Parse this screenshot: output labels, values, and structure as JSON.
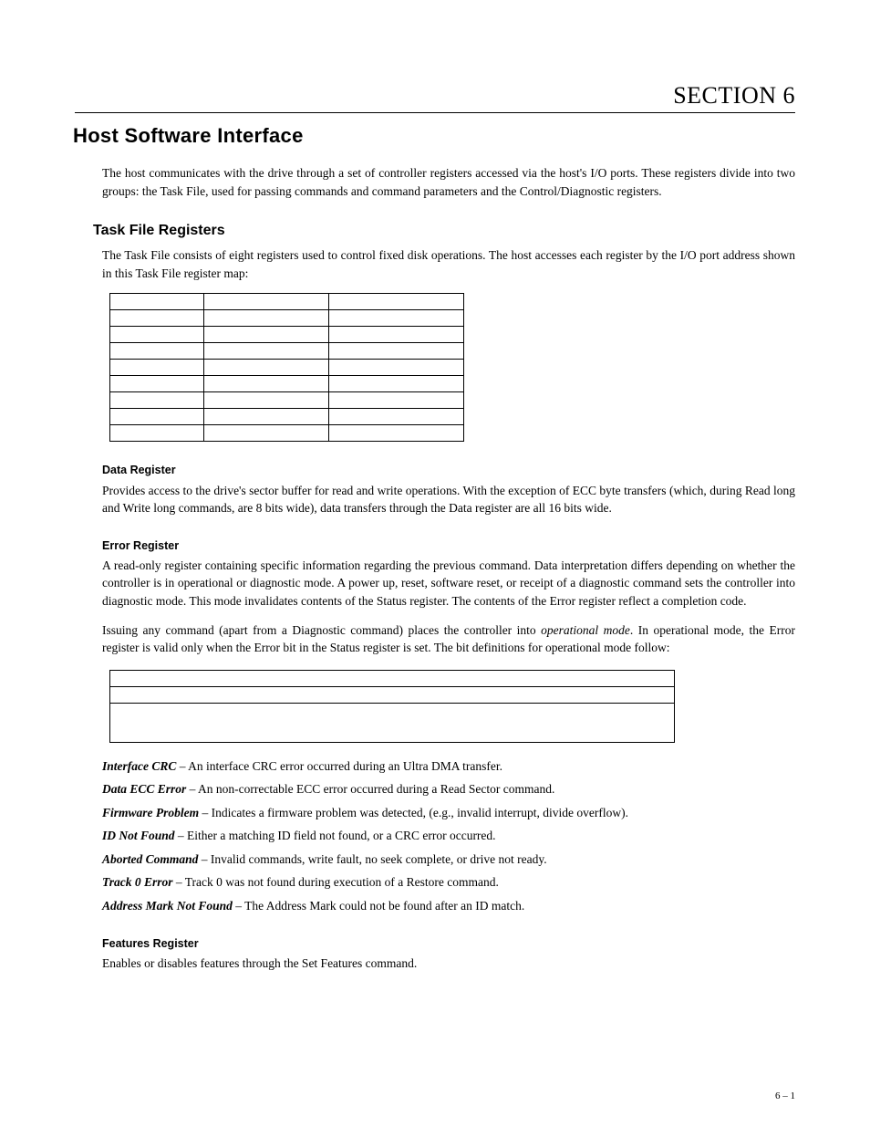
{
  "section_label": "SECTION 6",
  "title": "Host Software Interface",
  "intro": "The host communicates with the drive through a set of controller registers accessed via the host's I/O ports. These registers divide into two groups: the Task File, used for passing commands and command parameters and the Control/Diagnostic registers.",
  "tf": {
    "heading": "Task File Registers",
    "para": "The Task File consists of eight registers used to control fixed disk operations. The host accesses each register by the I/O port address shown in this Task File register map:"
  },
  "data_reg": {
    "heading": "Data Register",
    "para": "Provides access to the drive's sector buffer for read and write operations. With the exception of ECC byte transfers (which, during Read long and Write long commands, are 8 bits wide), data transfers through the Data register are all 16 bits wide."
  },
  "err_reg": {
    "heading": "Error Register",
    "p1": "A read-only register containing specific information regarding the previous command. Data interpretation differs depending on whether the controller is in operational or diagnostic mode. A power up, reset, software reset, or receipt of a diagnostic command sets the controller into diagnostic mode. This mode invalidates contents of the Status register. The contents of the Error register reflect a completion code.",
    "p2a": "Issuing any command (apart from a Diagnostic command) places the controller into ",
    "p2em": "operational mode",
    "p2b": ". In operational mode, the Error register is valid only when the Error bit in the Status register is set. The bit definitions for operational mode follow:"
  },
  "defs": [
    {
      "term": "Interface CRC",
      "text": " – An interface CRC error occurred during an Ultra DMA transfer."
    },
    {
      "term": "Data ECC Error",
      "text": " – An non-correctable ECC error occurred during a Read Sector command."
    },
    {
      "term": "Firmware Problem",
      "text": " – Indicates a firmware problem was detected, (e.g., invalid interrupt, divide overflow)."
    },
    {
      "term": "ID Not Found",
      "text": " – Either a matching ID field not found, or a CRC error occurred."
    },
    {
      "term": "Aborted Command",
      "text": " – Invalid commands, write fault, no seek complete, or drive not ready."
    },
    {
      "term": "Track 0 Error",
      "text": " – Track 0 was not found during execution of a Restore command."
    },
    {
      "term": "Address Mark Not Found",
      "text": " – The Address Mark could not be found after an ID match."
    }
  ],
  "feat": {
    "heading": "Features Register",
    "para": "Enables or disables features through the Set Features command."
  },
  "page_number": "6 – 1"
}
